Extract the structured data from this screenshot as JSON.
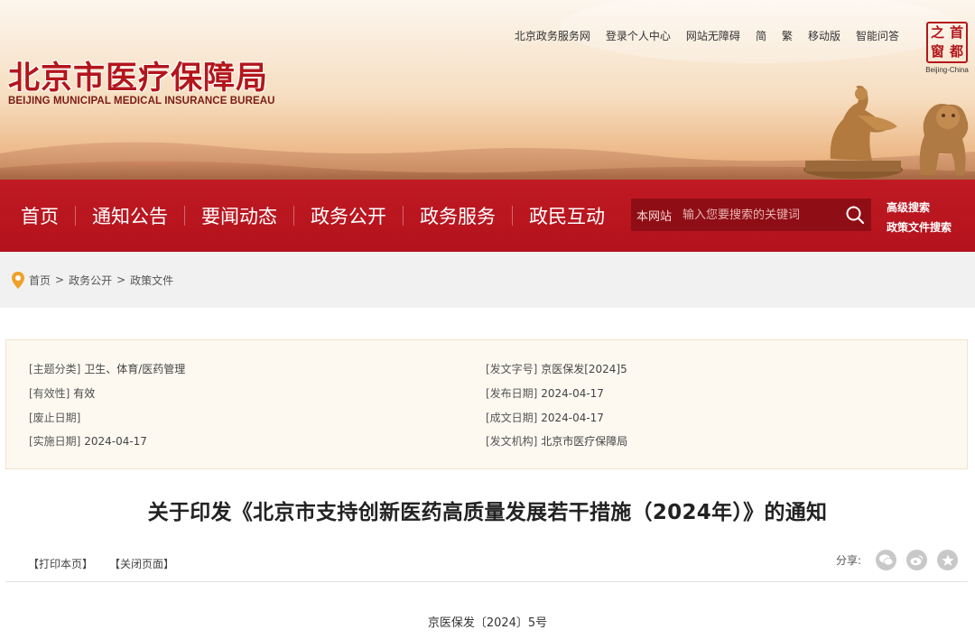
{
  "header": {
    "title": "北京市医疗保障局",
    "subtitle": "BEIJING MUNICIPAL MEDICAL INSURANCE BUREAU",
    "top_links": [
      "北京政务服务网",
      "登录个人中心",
      "网站无障碍",
      "简",
      "繁",
      "移动版",
      "智能问答"
    ],
    "capital_logo": {
      "chars": [
        "之",
        "首",
        "窗",
        "都"
      ],
      "caption": "Beijing-China"
    }
  },
  "nav": {
    "items": [
      "首页",
      "通知公告",
      "要闻动态",
      "政务公开",
      "政务服务",
      "政民互动"
    ],
    "search": {
      "scope": "本网站",
      "placeholder": "输入您要搜索的关键词",
      "icon": "search-icon"
    },
    "advanced_links": [
      "高级搜索",
      "政策文件搜索"
    ]
  },
  "breadcrumb": [
    "首页",
    "政务公开",
    "政策文件"
  ],
  "meta": {
    "topic_key": "[主题分类]",
    "topic": "卫生、体育/医药管理",
    "validity_key": "[有效性]",
    "validity": "有效",
    "repeal_key": "[废止日期]",
    "repeal": "",
    "effective_key": "[实施日期]",
    "effective": "2024-04-17",
    "docno_key": "[发文字号]",
    "docno": "京医保发[2024]5",
    "publish_key": "[发布日期]",
    "publish": "2024-04-17",
    "written_key": "[成文日期]",
    "written": "2024-04-17",
    "issuer_key": "[发文机构]",
    "issuer": "北京市医疗保障局"
  },
  "article": {
    "title": "关于印发《北京市支持创新医药高质量发展若干措施（2024年）》的通知",
    "print_label": "【打印本页】",
    "close_label": "【关闭页面】",
    "share_label": "分享:",
    "share_icons": [
      "wechat-icon",
      "weibo-icon",
      "qzone-icon"
    ],
    "doc_number": "京医保发〔2024〕5号"
  },
  "colors": {
    "brand_red": "#b3161b",
    "nav_red": "#c01a24",
    "search_bg": "#8f0e15"
  }
}
